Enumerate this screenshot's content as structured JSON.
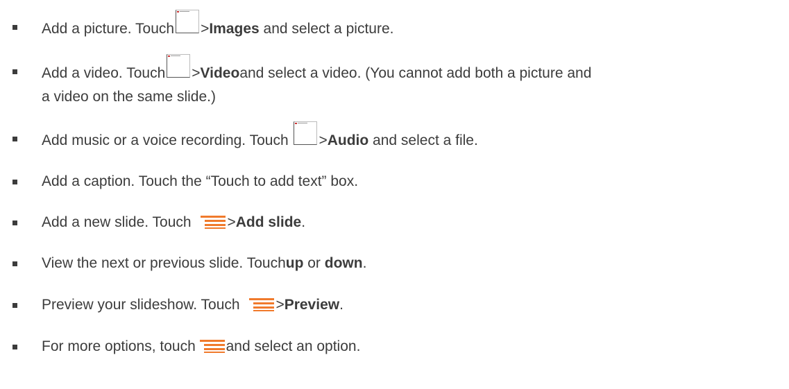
{
  "items": [
    {
      "pre": "Add a picture. Touch",
      "icon": "attach-icon",
      "mid": ">",
      "bold": "Images",
      "post": " and select a picture."
    },
    {
      "pre": "Add a video. Touch",
      "icon": "attach-icon",
      "mid": ">",
      "bold": "Video",
      "post": "and select a video. (You cannot add both a picture and",
      "line2": "a video on the same slide.)"
    },
    {
      "pre": "Add music or a voice recording. Touch ",
      "icon": "attach-icon",
      "mid": ">",
      "bold": "Audio",
      "post": " and select a file."
    },
    {
      "text": "Add a caption. Touch the “Touch to add text” box."
    },
    {
      "pre": "Add a new slide. Touch ",
      "icon": "menu-icon",
      "mid": ">",
      "bold": "Add slide",
      "post": "."
    },
    {
      "pre": "View the next or previous slide. Touch",
      "bold": "up",
      "mid2": " or ",
      "bold2": "down",
      "post": "."
    },
    {
      "pre": "Preview your slideshow. Touch ",
      "icon": "menu-icon",
      "mid": ">",
      "bold": "Preview",
      "post": "."
    },
    {
      "pre": "For more options, touch ",
      "icon": "menu-icon",
      "post": "and select an option."
    }
  ],
  "colors": {
    "text": "#3c3c3c",
    "menu_icon": "#f07a2c"
  }
}
